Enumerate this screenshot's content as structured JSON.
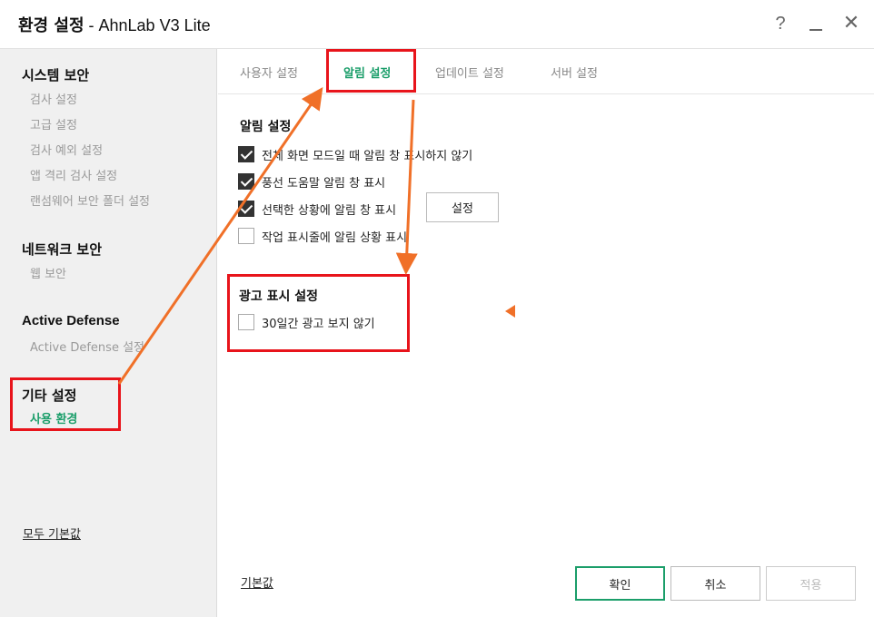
{
  "window": {
    "title_bold": "환경 설정",
    "title_app": " - AhnLab V3 Lite",
    "help_label": "?",
    "close_label": "✕"
  },
  "sidebar": {
    "sections": [
      {
        "title": "시스템 보안",
        "items": [
          "검사 설정",
          "고급 설정",
          "검사 예외 설정",
          "앱 격리 검사 설정",
          "랜섬웨어 보안 폴더 설정"
        ]
      },
      {
        "title": "네트워크 보안",
        "items": [
          "웹 보안"
        ]
      },
      {
        "title": "Active Defense",
        "items": [
          "Active Defense 설정"
        ]
      },
      {
        "title": "기타 설정",
        "items": [
          "사용 환경"
        ]
      }
    ],
    "reset_all": "모두 기본값"
  },
  "tabs": [
    "사용자 설정",
    "알림 설정",
    "업데이트 설정",
    "서버 설정"
  ],
  "active_tab": "알림 설정",
  "notification": {
    "title": "알림 설정",
    "options": [
      {
        "label": "전체 화면 모드일 때 알림 창 표시하지 않기",
        "checked": true
      },
      {
        "label": "풍선 도움말 알림 창 표시",
        "checked": true
      },
      {
        "label": "선택한 상황에 알림 창 표시",
        "checked": true
      },
      {
        "label": "작업 표시줄에 알림 상황 표시",
        "checked": false
      }
    ],
    "settings_button": "설정"
  },
  "ads": {
    "title": "광고 표시 설정",
    "option": {
      "label": "30일간 광고 보지 않기",
      "checked": false
    }
  },
  "footer": {
    "reset": "기본값",
    "ok": "확인",
    "cancel": "취소",
    "apply": "적용"
  },
  "colors": {
    "accent": "#1b9e6a",
    "annotation_red": "#e8141b",
    "annotation_orange": "#f07028"
  }
}
